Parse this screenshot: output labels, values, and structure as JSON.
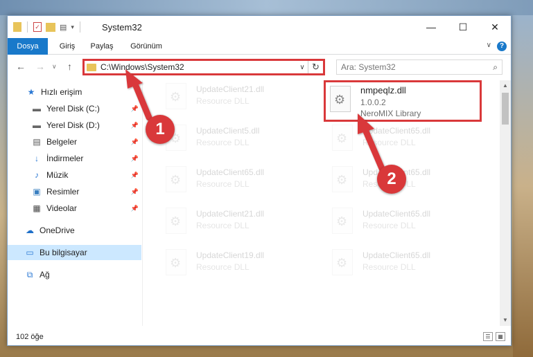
{
  "window": {
    "title": "System32",
    "controls": {
      "minimize": "—",
      "maximize": "☐",
      "close": "✕"
    }
  },
  "ribbon": {
    "tabs": [
      "Dosya",
      "Giriş",
      "Paylaş",
      "Görünüm"
    ],
    "help": "?",
    "collapse": "∨"
  },
  "nav": {
    "back": "←",
    "forward": "→",
    "up": "↑",
    "address": "C:\\Windows\\System32",
    "address_dropdown": "∨",
    "refresh": "↻",
    "search_placeholder": "Ara: System32",
    "search_icon": "⌕"
  },
  "sidebar": {
    "quick_access": "Hızlı erişim",
    "items": [
      {
        "label": "Yerel Disk (C:)",
        "icon": "drive-icon",
        "pinned": true
      },
      {
        "label": "Yerel Disk (D:)",
        "icon": "drive-icon",
        "pinned": true
      },
      {
        "label": "Belgeler",
        "icon": "documents-icon",
        "pinned": true
      },
      {
        "label": "İndirmeler",
        "icon": "downloads-icon",
        "pinned": true
      },
      {
        "label": "Müzik",
        "icon": "music-icon",
        "pinned": true
      },
      {
        "label": "Resimler",
        "icon": "pictures-icon",
        "pinned": true
      },
      {
        "label": "Videolar",
        "icon": "videos-icon",
        "pinned": true
      }
    ],
    "onedrive": "OneDrive",
    "this_pc": "Bu bilgisayar",
    "network": "Ağ"
  },
  "files": {
    "highlighted": {
      "name": "nmpeqlz.dll",
      "version": "1.0.0.2",
      "description": "NeroMIX Library"
    },
    "left_column": [
      {
        "name": "UpdateClient21.dll",
        "type": "Resource DLL"
      },
      {
        "name": "UpdateClient5.dll",
        "type": "Resource DLL"
      },
      {
        "name": "UpdateClient65.dll",
        "type": "Resource DLL"
      },
      {
        "name": "UpdateClient21.dll",
        "type": "Resource DLL"
      },
      {
        "name": "UpdateClient19.dll",
        "type": "Resource DLL"
      }
    ],
    "right_column": [
      {
        "name": "UpdateClient65.dll",
        "type": "Resource DLL"
      },
      {
        "name": "UpdateClient65.dll",
        "type": "Resource DLL"
      },
      {
        "name": "UpdateClient65.dll",
        "type": "Resource DLL"
      },
      {
        "name": "UpdateClient65.dll",
        "type": "Resource DLL"
      }
    ]
  },
  "status": {
    "count": "102 öğe"
  },
  "annotations": {
    "step1": "1",
    "step2": "2"
  },
  "colors": {
    "accent": "#1979ca",
    "highlight": "#d9383a",
    "selected": "#cce8ff"
  }
}
